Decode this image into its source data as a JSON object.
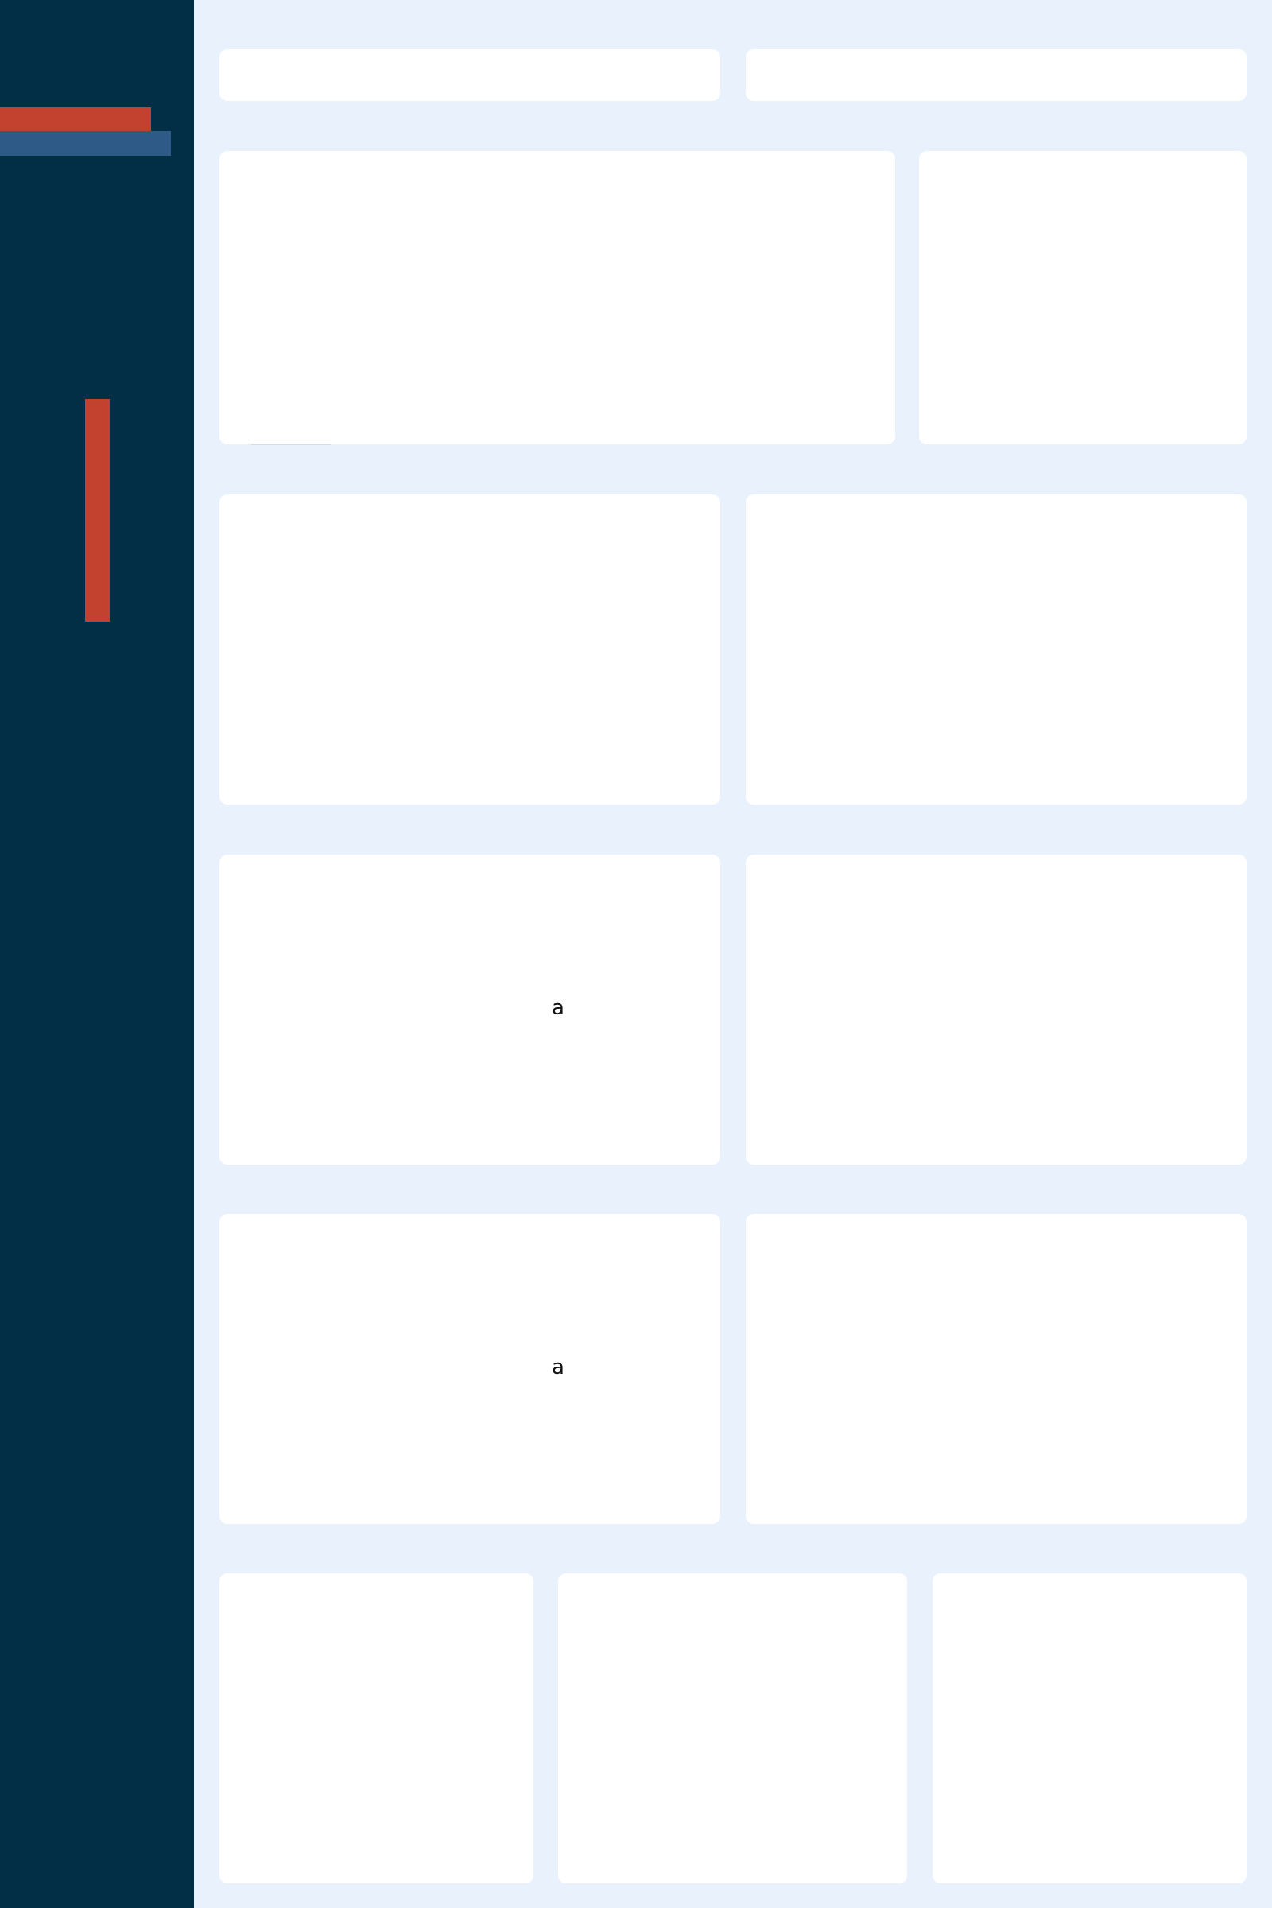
{
  "colors": {
    "sidebar": "#022f45",
    "page_bg": "#e8f1fc",
    "card_bg": "#ffffff",
    "accent_red": "#c3412f",
    "accent_blue": "#2d5a87"
  },
  "sidebar": {
    "accent_bars": [
      {
        "name": "accent-bar-red",
        "color": "#c3412f"
      },
      {
        "name": "accent-bar-blue",
        "color": "#2d5a87"
      },
      {
        "name": "accent-bar-red-vertical",
        "color": "#c3412f"
      }
    ]
  },
  "cards": {
    "row3_left_glyph": "a",
    "row4_left_glyph": "a"
  }
}
